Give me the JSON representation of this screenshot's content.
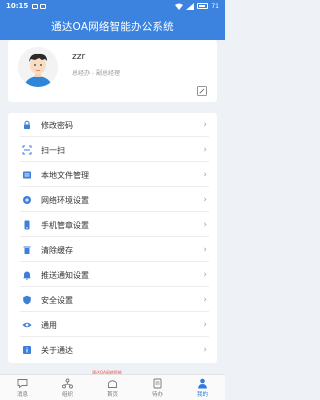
{
  "status_bar": {
    "time": "10:15",
    "battery": "71"
  },
  "header": {
    "title": "通达OA网络智能办公系统"
  },
  "profile": {
    "name": "zzr",
    "role": "总经办 - 副总经理"
  },
  "menu": [
    {
      "label": "修改密码",
      "icon": "lock-icon"
    },
    {
      "label": "扫一扫",
      "icon": "scan-icon"
    },
    {
      "label": "本地文件管理",
      "icon": "folder-icon"
    },
    {
      "label": "网络环境设置",
      "icon": "network-icon"
    },
    {
      "label": "手机管章设置",
      "icon": "phone-icon"
    },
    {
      "label": "清除缓存",
      "icon": "trash-icon"
    },
    {
      "label": "推送通知设置",
      "icon": "bell-icon"
    },
    {
      "label": "安全设置",
      "icon": "shield-icon"
    },
    {
      "label": "通用",
      "icon": "eye-icon"
    },
    {
      "label": "关于通达",
      "icon": "info-icon"
    }
  ],
  "tabs": [
    {
      "label": "消息",
      "icon": "message-icon"
    },
    {
      "label": "组织",
      "icon": "org-icon"
    },
    {
      "label": "首页",
      "icon": "home-icon"
    },
    {
      "label": "待办",
      "icon": "todo-icon"
    },
    {
      "label": "我的",
      "icon": "user-icon",
      "active": true
    }
  ],
  "peek_text": "通达OA网络智能",
  "colors": {
    "primary": "#3b83df",
    "active_tab": "#2f7be0",
    "icon_blue": "#3d7fd9"
  }
}
